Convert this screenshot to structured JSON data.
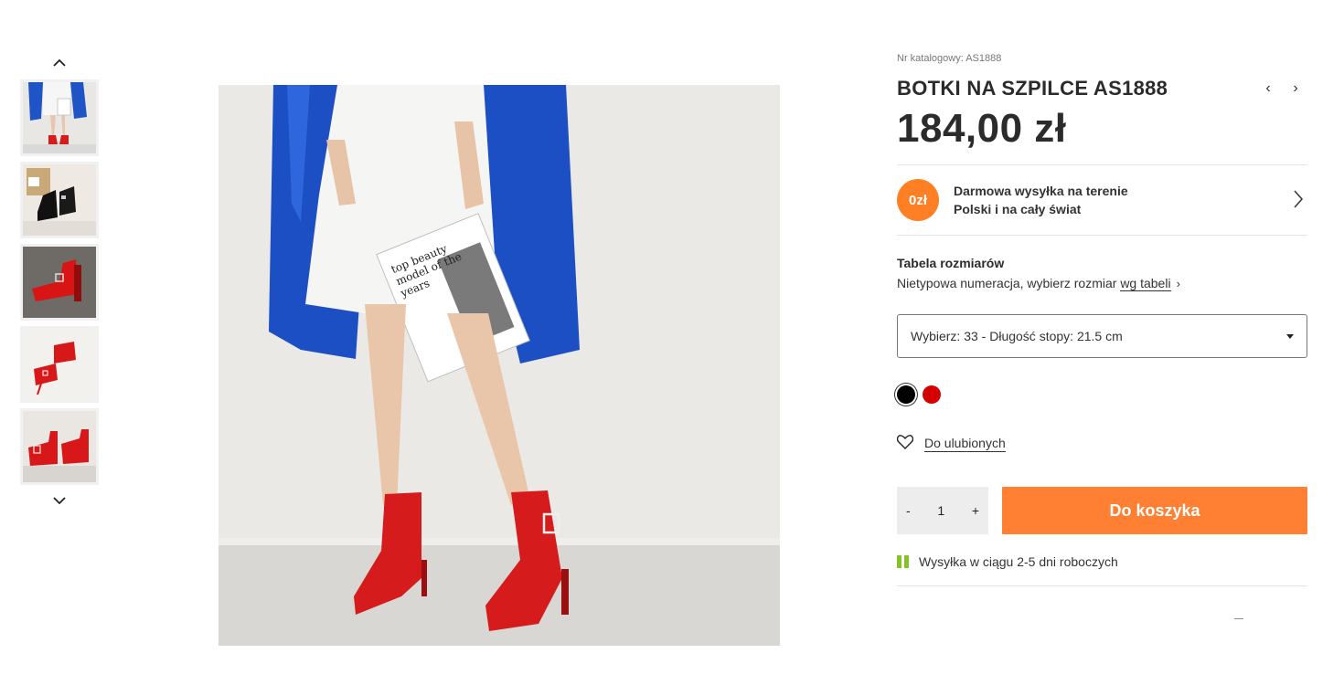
{
  "gallery": {
    "up_icon": "chevron-up-icon",
    "down_icon": "chevron-down-icon",
    "thumbnails": [
      "thumb-1",
      "thumb-2",
      "thumb-3",
      "thumb-4",
      "thumb-5"
    ],
    "magazine_text": "top beauty model of the years"
  },
  "product": {
    "catalog_label": "Nr katalogowy: AS1888",
    "title": "BOTKI NA SZPILCE AS1888",
    "price": "184,00 zł",
    "prev_icon": "‹",
    "next_icon": "›"
  },
  "shipping": {
    "badge": "0zł",
    "line1": "Darmowa wysyłka na terenie",
    "line2": "Polski i na cały świat"
  },
  "sizes": {
    "title": "Tabela rozmiarów",
    "desc": "Nietypowa numeracja, wybierz rozmiar",
    "link": "wg tabeli",
    "selected": "Wybierz: 33 - Długość stopy: 21.5 cm"
  },
  "colors": {
    "options": [
      "#000000",
      "#d40000"
    ],
    "selected": "#000000"
  },
  "favorites": {
    "label": "Do ulubionych"
  },
  "cart": {
    "minus": "-",
    "quantity": "1",
    "plus": "+",
    "button": "Do koszyka",
    "accent": "#ff7f33"
  },
  "delivery": {
    "text": "Wysyłka w ciągu 2-5 dni roboczych",
    "color": "#86c226"
  },
  "footer_mark": "—"
}
